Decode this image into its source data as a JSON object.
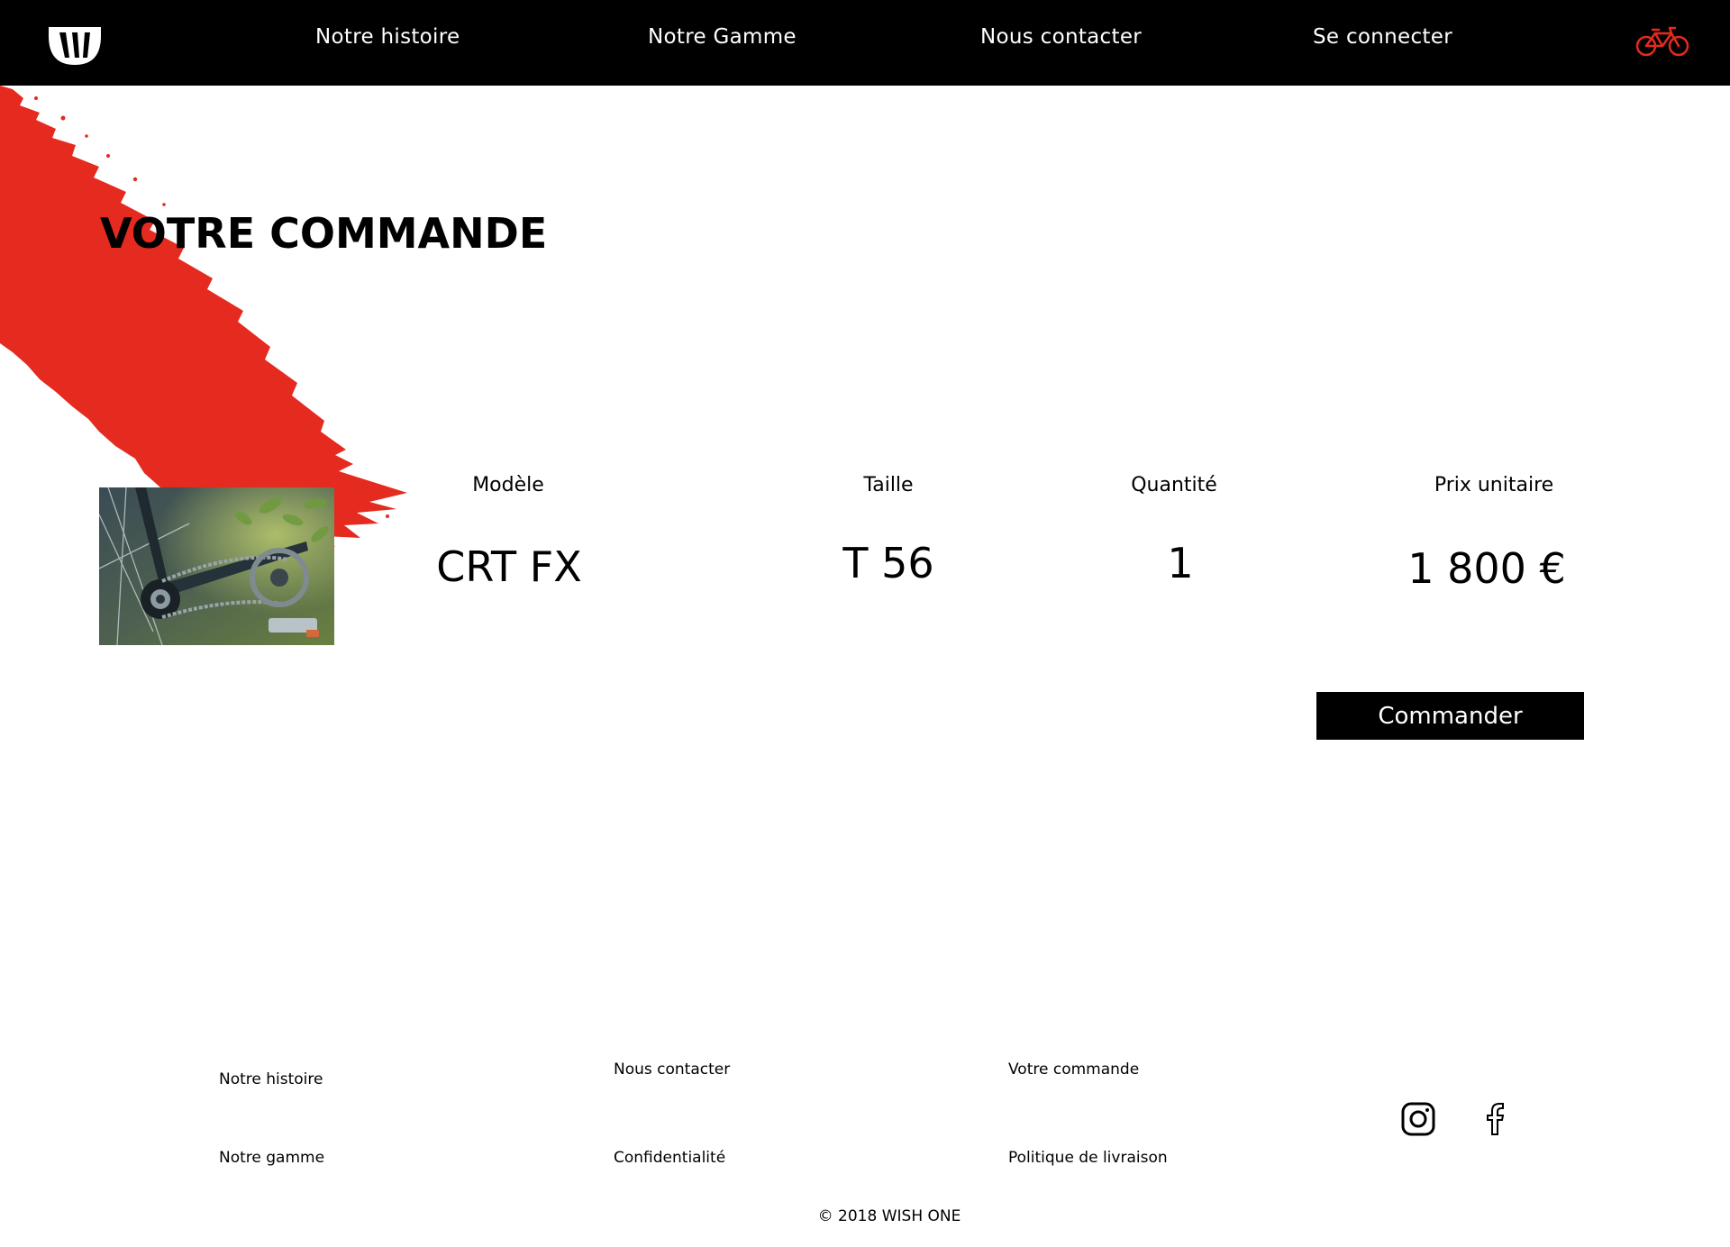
{
  "nav": {
    "logo": "wish-one-logo",
    "links": [
      {
        "label": "Notre histoire"
      },
      {
        "label": "Notre Gamme"
      },
      {
        "label": "Nous contacter"
      },
      {
        "label": "Se connecter"
      }
    ],
    "cart_icon": "bicycle-icon"
  },
  "page": {
    "title": "VOTRE COMMANDE"
  },
  "order": {
    "headers": {
      "model": "Modèle",
      "size": "Taille",
      "quantity": "Quantité",
      "unit_price": "Prix unitaire"
    },
    "item": {
      "image": "bike-chain-photo",
      "model": "CRT FX",
      "size": "T 56",
      "quantity": "1",
      "unit_price": "1 800 €"
    },
    "button_label": "Commander"
  },
  "footer": {
    "col1": [
      "Notre histoire",
      "Notre gamme"
    ],
    "col2": [
      "Nous contacter",
      "Confidentialité"
    ],
    "col3": [
      "Votre commande",
      "Politique de livraison"
    ],
    "social": [
      "instagram-icon",
      "facebook-icon"
    ],
    "copyright": "© 2018 WISH ONE"
  },
  "colors": {
    "accent": "#e52a1f",
    "header_bg": "#000000",
    "text": "#000000"
  }
}
